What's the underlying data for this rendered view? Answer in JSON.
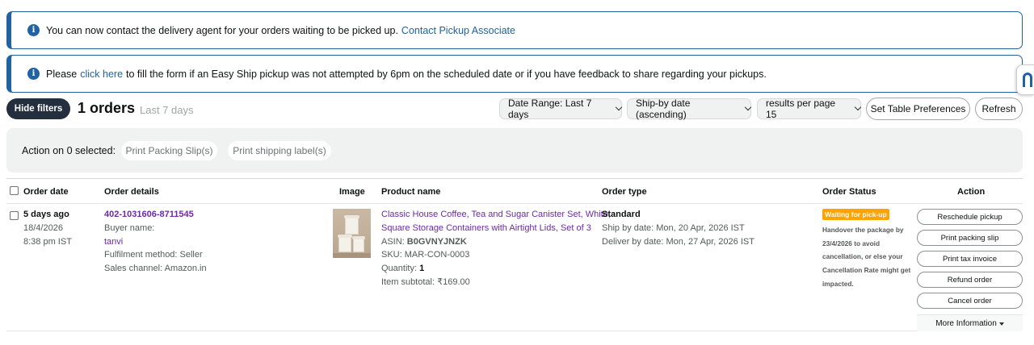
{
  "alerts": {
    "first": {
      "text": "You can now contact the delivery agent for your orders waiting to be picked up.",
      "link": "Contact Pickup Associate"
    },
    "second": {
      "prefix": "Please",
      "link": "click here",
      "suffix": "to fill the form if an Easy Ship pickup was not attempted by 6pm on the scheduled date or if you have feedback to share regarding your pickups."
    },
    "icon_glyph": "i"
  },
  "toolbar": {
    "hide_filters": "Hide filters",
    "orders_count": "1 orders",
    "orders_range": "Last 7 days",
    "date_range": "Date Range: Last 7 days",
    "sort": "Ship-by date (ascending)",
    "per_page": "results per page 15",
    "table_prefs": "Set Table Preferences",
    "refresh": "Refresh"
  },
  "action_bar": {
    "label": "Action on 0 selected:",
    "print_packing": "Print Packing Slip(s)",
    "print_shipping": "Print shipping label(s)"
  },
  "table": {
    "headers": {
      "order_date": "Order date",
      "order_details": "Order details",
      "image": "Image",
      "product_name": "Product name",
      "order_type": "Order type",
      "order_status": "Order Status",
      "action": "Action"
    },
    "rows": [
      {
        "age": "5 days ago",
        "date": "18/4/2026",
        "time": "8:38 pm IST",
        "order_id": "402-1031606-8711545",
        "buyer_label": "Buyer name:",
        "buyer_name": "tanvi",
        "fulfilment": "Fulfilment method: Seller",
        "channel": "Sales channel: Amazon.in",
        "product_line1": "Classic House Coffee, Tea and Sugar Canister Set, White,",
        "product_line2": "Square Storage Containers with Airtight Lids, Set of 3",
        "asin_label": "ASIN:",
        "asin": "B0GVNYJNZK",
        "sku": "SKU: MAR-CON-0003",
        "qty_label": "Quantity:",
        "qty": "1",
        "subtotal": "Item subtotal: ₹169.00",
        "order_type": "Standard",
        "ship_by": "Ship by date: Mon, 20 Apr, 2026 IST",
        "deliver_by": "Deliver by date: Mon, 27 Apr, 2026 IST",
        "status_badge": "Waiting for pick-up",
        "status_note": "Handover the package by 23/4/2026 to avoid cancellation, or else your Cancellation Rate might get impacted.",
        "actions": {
          "reschedule": "Reschedule pickup",
          "packing_slip": "Print packing slip",
          "tax_invoice": "Print tax invoice",
          "refund": "Refund order",
          "cancel": "Cancel order",
          "more_info": "More Information"
        }
      }
    ]
  },
  "colors": {
    "accent": "#2162a1",
    "link_purple": "#6c2aa5",
    "status_orange": "#ffa300",
    "dark_button": "#232f3e"
  }
}
